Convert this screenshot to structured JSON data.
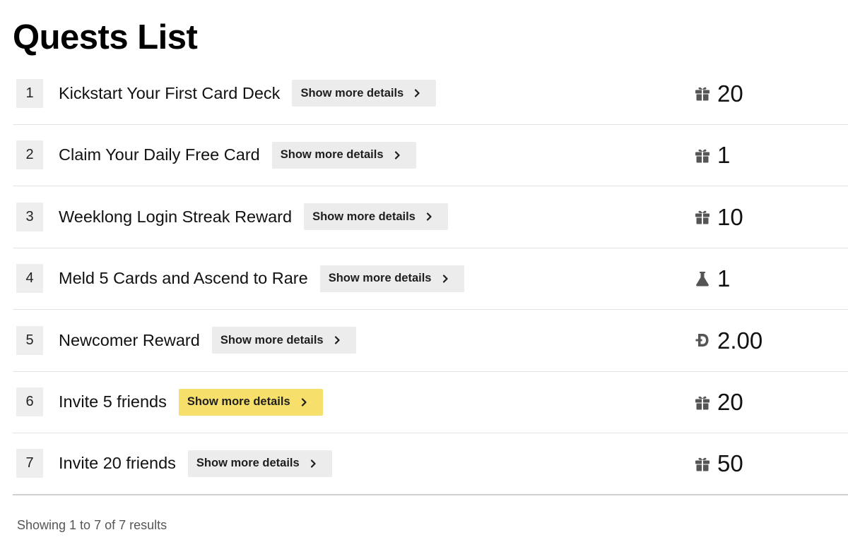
{
  "page": {
    "title": "Quests List"
  },
  "quests": [
    {
      "index": "1",
      "title": "Kickstart Your First Card Deck",
      "details_label": "Show more details",
      "reward_icon": "gift-icon",
      "reward_value": "20",
      "highlighted": false
    },
    {
      "index": "2",
      "title": "Claim Your Daily Free Card",
      "details_label": "Show more details",
      "reward_icon": "gift-icon",
      "reward_value": "1",
      "highlighted": false
    },
    {
      "index": "3",
      "title": "Weeklong Login Streak Reward",
      "details_label": "Show more details",
      "reward_icon": "gift-icon",
      "reward_value": "10",
      "highlighted": false
    },
    {
      "index": "4",
      "title": "Meld 5 Cards and Ascend to Rare",
      "details_label": "Show more details",
      "reward_icon": "flask-icon",
      "reward_value": "1",
      "highlighted": false
    },
    {
      "index": "5",
      "title": "Newcomer Reward",
      "details_label": "Show more details",
      "reward_icon": "coin-d-icon",
      "reward_value": "2.00",
      "highlighted": false
    },
    {
      "index": "6",
      "title": "Invite 5 friends",
      "details_label": "Show more details",
      "reward_icon": "gift-icon",
      "reward_value": "20",
      "highlighted": true
    },
    {
      "index": "7",
      "title": "Invite 20 friends",
      "details_label": "Show more details",
      "reward_icon": "gift-icon",
      "reward_value": "50",
      "highlighted": false
    }
  ],
  "footer": {
    "summary": "Showing 1 to 7 of 7 results"
  },
  "colors": {
    "highlight": "#f7df6c",
    "button_bg": "#ececec",
    "index_bg": "#eeeeee"
  }
}
